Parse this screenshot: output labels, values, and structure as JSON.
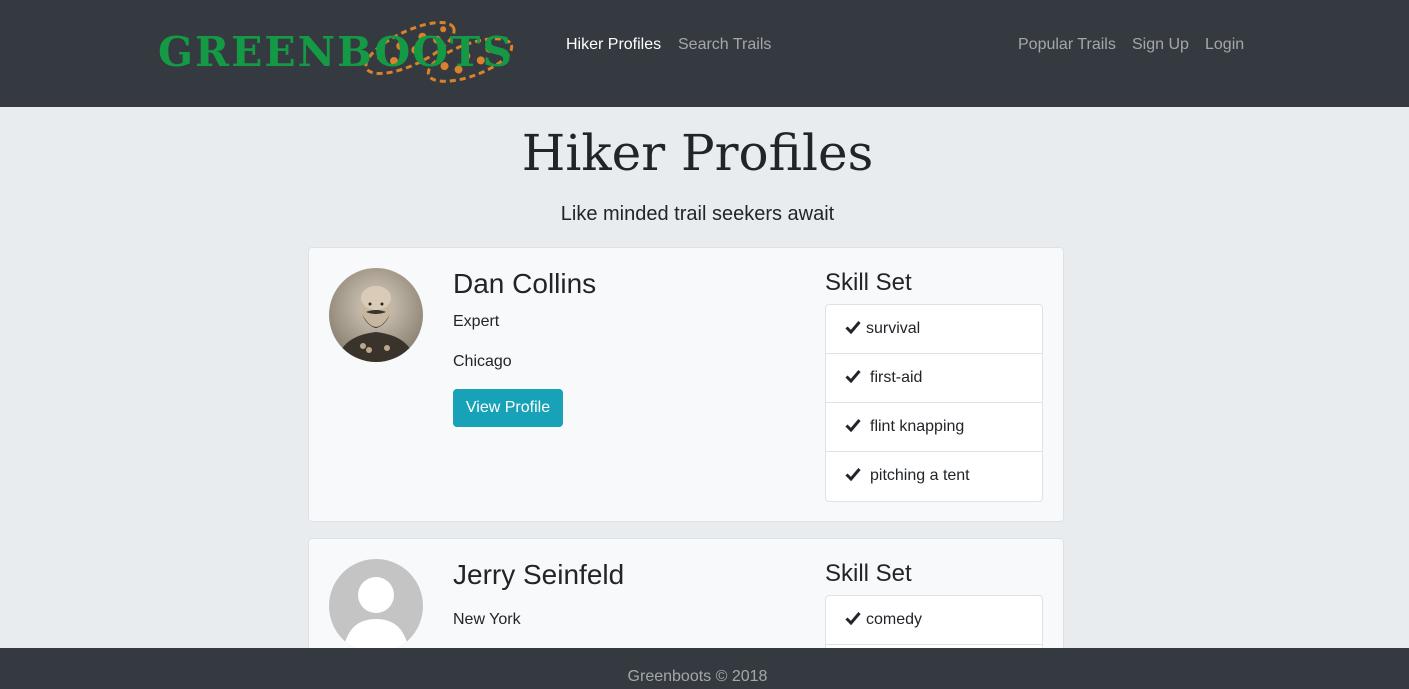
{
  "brand": {
    "name": "GREENBOOTS"
  },
  "nav": {
    "left": [
      "Hiker Profiles",
      "Search Trails"
    ],
    "right": [
      "Popular Trails",
      "Sign Up",
      "Login"
    ],
    "active": "Hiker Profiles"
  },
  "page": {
    "title": "Hiker Profiles",
    "subtitle": "Like minded trail seekers await"
  },
  "profiles": [
    {
      "name": "Dan Collins",
      "level": "Expert",
      "city": "Chicago",
      "button_label": "View Profile",
      "skills_title": "Skill Set",
      "skills": [
        "survival",
        "first-aid",
        "flint knapping",
        "pitching a tent"
      ]
    },
    {
      "name": "Jerry Seinfeld",
      "city": "New York",
      "skills_title": "Skill Set",
      "skills": [
        "comedy"
      ]
    }
  ],
  "footer": {
    "text": "Greenboots © 2018"
  },
  "colors": {
    "navbar": "#343a40",
    "brand_green": "#149a45",
    "boot_orange": "#d9822b",
    "button": "#17a2b8",
    "page_bg": "#e9ecef"
  },
  "icons": {
    "skill": "check-icon",
    "brand": "bootprint-icon",
    "default_avatar": "user-silhouette-icon"
  }
}
